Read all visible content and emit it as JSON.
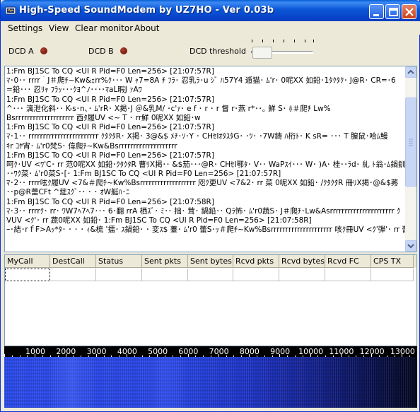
{
  "window": {
    "title": "High-Speed SoundModem by UZ7HO - Ver 0.03b",
    "buttons": {
      "minimize": "minimize",
      "maximize": "maximize",
      "close": "close"
    }
  },
  "menu": {
    "settings": "Settings",
    "view": "View",
    "clear_monitor": "Clear monitor",
    "about": "About"
  },
  "dcd": {
    "a_label": "DCD A",
    "b_label": "DCD B",
    "threshold_label": "DCD threshold",
    "led_color": "#7a1a10",
    "threshold_level": 0.05
  },
  "monitor": {
    "lines": [
      "1:Fm BJ1SC To CQ <UI R Pid=F0 Len=256> [21:07:57R]",
      "ﾏ･0･･ rrrr｀J＃爬ﾁ~Kw&ｪrr%ｸ･･･ W ｬ7=8A ﾁ ﾌﾗ･ 忍乳ﾗ･u ｼﾞ ﾊ57Y4 遁猫･ ﾑ'r･ 0呢XX 如鉛･1ﾀｸﾀｸ･ J@R･ CR=･6",
      "=鉛･･･ 忍ﾘｬ ﾌﾗｯ･･･ｸﾖ^ﾉ････ﾏaL暇J ｧAﾜ",
      "1:Fm BJ1SC To CQ <UI R Pid=F0 Len=256> [21:07:57R]",
      "^･･･ 漓泄化斜･･ K-s･n､･ ﾑ'rR･ X掲･J ＠&乳M/ ･c'ｧ･ e f ･ r ･ r 督 r･燕 r*･･｡ 鮮 S･ ﾎ＃爬ﾁ Lw%",
      "Bsrrrrrrrrrrrrrrrrrrrr 酉ﾀ履UV       <~ T ･ rr鮮 0呢XX 如鉛･w",
      "1:Fm BJ1SC To CQ <UI R Pid=F0 Len=256> [21:07:57R]",
      "ﾏ･1･･ rrrrrrrrrrrrrrrrrrrrrrrr ｸﾀｸﾀR･ X掲･ 3@&$ ﾒﾁ･ｿ･Y ･ CHｾIｵﾀｽﾀG･ ･ﾂ･ ･7W鋳 ﾊ桁ﾄ･ K sR= ･･･ T 膣鼠･哈ﾑ鰻",
      "ｷr ｺﾔ宵･ ﾑ'r0梵S･ 偉爬ﾁ~Kw&Bsrrrrrrrrrrrrrrrrrrrr",
      "1:Fm BJ1SC To CQ <UI R Pid=F0 Len=256> [21:07:57R]",
      "呵ｸ･UV   <ﾜ'C･ rr 范0呢XX 如鉛･ｸﾀｸﾀR 曹ﾘX掲･･ &$茄･･･@R･ CHｾI鄂ﾀ･ V･･ WaPｽｲ･･･ W･ )A･ 桂･･ﾗd･ 糺 ﾄ翁･ﾑ鍋釧",
      "･･ﾜｸ菜･ ﾑ'r0菜S･[･ 1:Fm BJ1SC To CQ <UI R Pid=F0 Len=256> [21:07:57R]",
      "ﾏ･2･･ rrrr呟ｸ履UV <7&＃爬ﾁ~Kw%Bsrrrrrrrrrrrrrrrrrrr 咫ｸ更UV   <7&2･ rr 菜 0呢XX 如鉛･ /ｸﾀｸﾀR 冊ﾘX掲･@&$莠",
      "･･p@R蕾CFt ^莚ｽｸﾞ･･ ･ ･ ｵW艇ﾊ･ﾆ",
      "1:Fm BJ1SC To CQ <UI R Pid=F0 Len=256> [21:07:58R]",
      "ﾏ･3･･ rrrrｸ･ rr･ ﾜW7ﾍ7ﾍ7･･･ 6･翻 rrA 栖ｽﾞ･ ﾐ･･ 拙･ 茸･ 鍋鉛･･ Qﾗ怖･ ﾑ'r0蔬S･ J＃爬ﾁ･Lw&Asrrrrrrrrrrrrrrrrrrrrrr ｸ",
      "VUV      <ｸ'･ rr 蔬0呢XX 如鉛･ 1:Fm BJ1SC To CQ <UI R Pid=F0 Len=256> [21:07:58R]",
      "ｰ･結･rｆF>Aｯ*ﾀ･ ･ ･ ･ ｨ&梳 '擂･ ｽ鍋鉛･ ･ 変ｽ$ 薹･ ﾑ'r0 蕾S･ｯ＃爬ﾁ~Kw%Bsrrrrrrrrrrrrrrrrrrrrr 咳ｸ冊UV   <ｸ'弾'･ rr 蕾0呢XX"
    ]
  },
  "table": {
    "columns": [
      "MyCall",
      "DestCall",
      "Status",
      "Sent pkts",
      "Sent bytes",
      "Rcvd pkts",
      "Rcvd bytes",
      "Rcvd FC",
      "CPS TX"
    ]
  },
  "waterfall": {
    "freq_labels": [
      "1000",
      "2000",
      "3000",
      "4000",
      "5000",
      "6000",
      "7000",
      "8000",
      "9000",
      "10000",
      "11000",
      "12000",
      "13000"
    ]
  }
}
